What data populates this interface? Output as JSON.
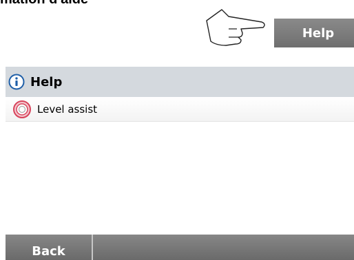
{
  "document": {
    "heading": "mation d'aide"
  },
  "top_button": {
    "label": "Help",
    "icon": "pointing-hand-icon"
  },
  "help_panel": {
    "title": "Help",
    "icon": "info-icon",
    "items": [
      {
        "label": "Level assist",
        "icon": "target-icon"
      }
    ]
  },
  "bottom_bar": {
    "back_label": "Back"
  },
  "colors": {
    "header_bg": "#d4d9de",
    "button_gray": "#7c7c7c",
    "info_blue": "#1f5fa8",
    "target_red": "#d8445c"
  }
}
